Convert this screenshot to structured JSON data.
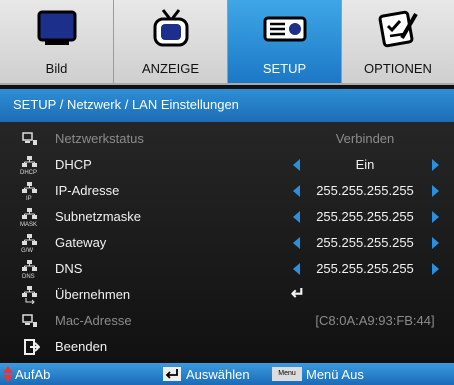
{
  "tabs": [
    {
      "label": "Bild",
      "icon": "monitor-icon"
    },
    {
      "label": "ANZEIGE",
      "icon": "tv-icon"
    },
    {
      "label": "SETUP",
      "icon": "projector-icon"
    },
    {
      "label": "OPTIONEN",
      "icon": "checklist-icon"
    }
  ],
  "active_tab": "SETUP",
  "breadcrumb": "SETUP / Netzwerk / LAN Einstellungen",
  "items": [
    {
      "label": "Netzwerkstatus",
      "value": "Verbinden",
      "icon": "network-status-icon",
      "tag": ""
    },
    {
      "label": "DHCP",
      "value": "Ein",
      "icon": "network-icon",
      "tag": "DHCP"
    },
    {
      "label": "IP-Adresse",
      "value": "255.255.255.255",
      "icon": "network-icon",
      "tag": "IP"
    },
    {
      "label": "Subnetzmaske",
      "value": "255.255.255.255",
      "icon": "network-icon",
      "tag": "MASK"
    },
    {
      "label": "Gateway",
      "value": "255.255.255.255",
      "icon": "network-icon",
      "tag": "G/W"
    },
    {
      "label": "DNS",
      "value": "255.255.255.255",
      "icon": "network-icon",
      "tag": "DNS"
    },
    {
      "label": "Übernehmen",
      "value": "↵",
      "icon": "network-apply-icon",
      "tag": ""
    },
    {
      "label": "Mac-Adresse",
      "value": "[C8:0A:A9:93:FB:44]",
      "icon": "network-status-icon",
      "tag": ""
    },
    {
      "label": "Beenden",
      "value": "",
      "icon": "exit-icon",
      "tag": ""
    }
  ],
  "hints": {
    "nav": "AufAb",
    "select": "Auswählen",
    "menu_key": "Menu",
    "menu_exit": "Menü Aus"
  },
  "colors": {
    "accent": "#1f77c8",
    "arrow": "#2b8fe0",
    "background": "#1a1a1a",
    "dim_text": "#8b8b8b"
  }
}
